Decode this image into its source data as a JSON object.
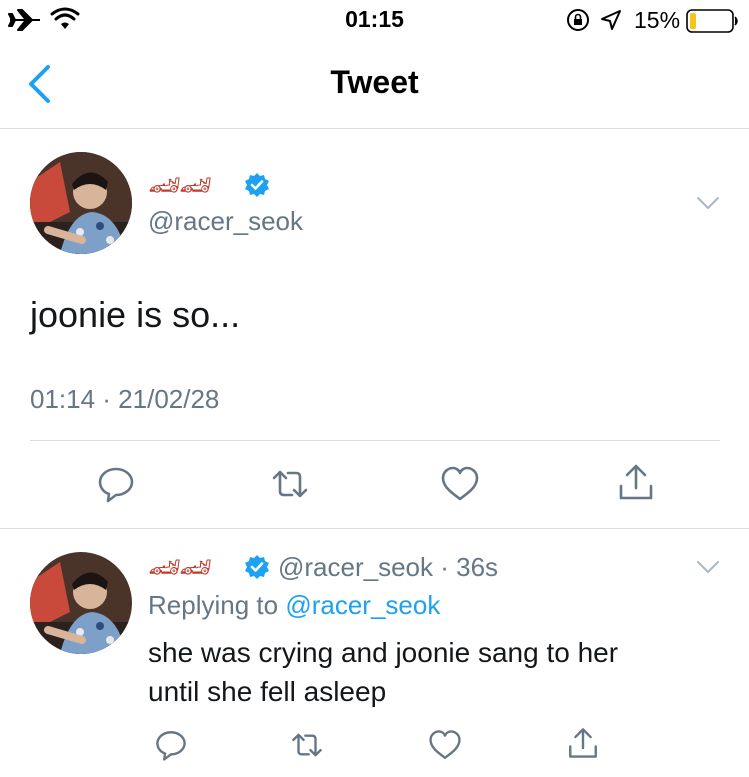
{
  "status_bar": {
    "time": "01:15",
    "battery_percent": "15%",
    "icons": [
      "airplane-icon",
      "wifi-icon",
      "orientation-lock-icon",
      "location-icon",
      "battery-icon"
    ]
  },
  "nav": {
    "title": "Tweet",
    "back_icon": "chevron-left-icon"
  },
  "main_tweet": {
    "display_name": "🏎🏎",
    "verified": true,
    "handle": "@racer_seok",
    "text": "joonie is so...",
    "timestamp": "01:14 · 21/02/28",
    "actions": [
      "reply-icon",
      "retweet-icon",
      "like-icon",
      "share-icon"
    ]
  },
  "reply_tweet": {
    "display_name": "🏎🏎",
    "verified": true,
    "handle": "@racer_seok",
    "time_ago": "36s",
    "replying_to_prefix": "Replying to",
    "replying_to_handle": "@racer_seok",
    "text_line1": "she was crying and joonie sang to her",
    "text_line2": "until she fell asleep",
    "actions": [
      "reply-icon",
      "retweet-icon",
      "like-icon",
      "share-icon"
    ]
  },
  "colors": {
    "accent": "#1da1f2",
    "muted": "#657786",
    "divider": "#d8dde1",
    "battery_low": "#f5c518"
  }
}
